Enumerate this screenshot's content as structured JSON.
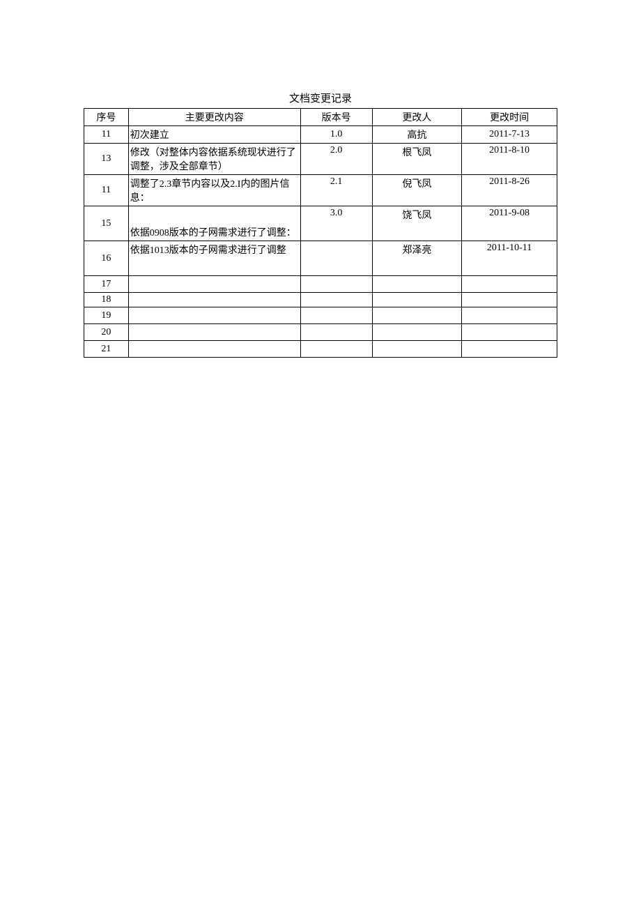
{
  "title": "文档变更记录",
  "headers": {
    "seq": "序号",
    "content": "主要更改内容",
    "version": "版本号",
    "changer": "更改人",
    "date": "更改时间"
  },
  "rows": [
    {
      "seq": "11",
      "content": "初次建立",
      "version": "1.0",
      "changer": "高抗",
      "date": "2011-7-13",
      "rowclass": "h-small"
    },
    {
      "seq": "13",
      "content": "修改（对整体内容依据系统现状进行了调整，涉及全部章节）",
      "version": "2.0",
      "changer": "根飞凤",
      "date": "2011-8-10",
      "rowclass": "h-mid",
      "topcells": true
    },
    {
      "seq": "11",
      "content": "调整了2.3章节内容以及2.I内的图片信息：",
      "version": "2.1",
      "changer": "倪飞凤",
      "date": "2011-8-26",
      "rowclass": "h-mid",
      "topcells": true,
      "contentTop": true
    },
    {
      "seq": "15",
      "content": "依据0908版本的子网需求进行了调整：",
      "version": "3.0",
      "changer": "饶飞凤",
      "date": "2011-9-08",
      "rowclass": "h-mid2",
      "topcells": true,
      "contentBottom": true
    },
    {
      "seq": "16",
      "content": "依据1013版本的子网需求进行了调整",
      "version": "",
      "changer": "郑泽亮",
      "date": "2011-10-11",
      "rowclass": "h-mid2",
      "topcells": true,
      "contentTop": true
    },
    {
      "seq": "17",
      "content": "",
      "version": "",
      "changer": "",
      "date": "",
      "rowclass": "h-small2"
    },
    {
      "seq": "18",
      "content": "",
      "version": "",
      "changer": "",
      "date": "",
      "rowclass": "h-small"
    },
    {
      "seq": "19",
      "content": "",
      "version": "",
      "changer": "",
      "date": "",
      "rowclass": "h-small2"
    },
    {
      "seq": "20",
      "content": "",
      "version": "",
      "changer": "",
      "date": "",
      "rowclass": "h-small2"
    },
    {
      "seq": "21",
      "content": "",
      "version": "",
      "changer": "",
      "date": "",
      "rowclass": "h-small2"
    }
  ]
}
